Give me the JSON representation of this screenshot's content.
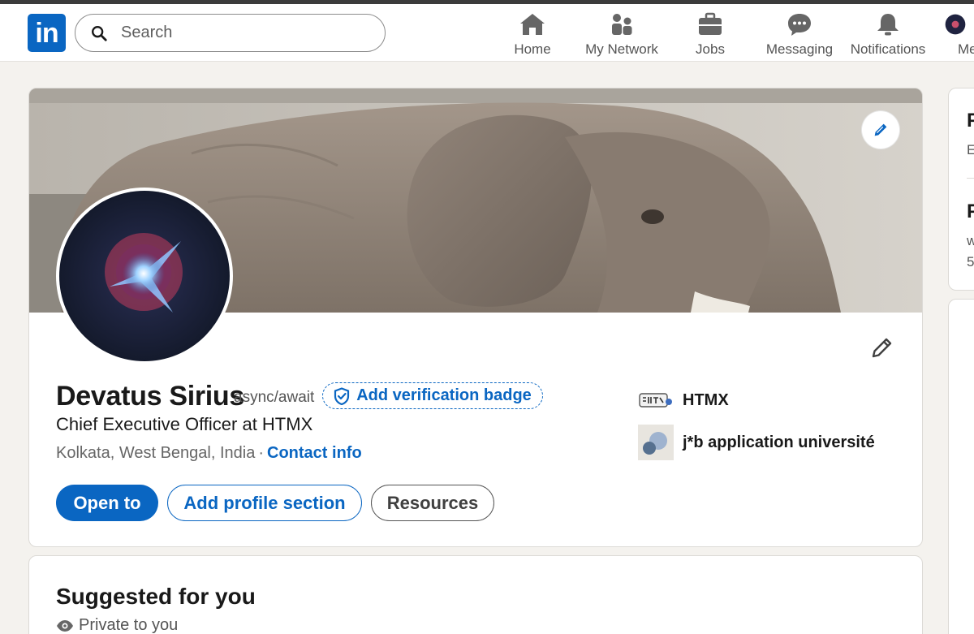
{
  "colors": {
    "brand": "#0a66c2",
    "background": "#f4f2ee",
    "card": "#ffffff"
  },
  "nav": {
    "logo_text": "in",
    "search_placeholder": "Search",
    "items": [
      {
        "label": "Home",
        "icon": "home-icon"
      },
      {
        "label": "My Network",
        "icon": "network-icon"
      },
      {
        "label": "Jobs",
        "icon": "briefcase-icon"
      },
      {
        "label": "Messaging",
        "icon": "messaging-icon"
      },
      {
        "label": "Notifications",
        "icon": "bell-icon"
      },
      {
        "label": "Me",
        "icon": "avatar"
      }
    ]
  },
  "profile": {
    "name": "Devatus Sirius",
    "pronouns": "async/await",
    "verification_label": "Add verification badge",
    "headline": "Chief Executive Officer at HTMX",
    "location": "Kolkata, West Bengal, India",
    "location_separator": "·",
    "contact_label": "Contact info",
    "buttons": {
      "open_to": "Open to",
      "add_section": "Add profile section",
      "resources": "Resources"
    },
    "organizations": [
      {
        "name": "HTMX",
        "icon": "htmx-logo"
      },
      {
        "name": "j*b application université",
        "icon": "school-placeholder-logo"
      }
    ]
  },
  "suggested": {
    "title": "Suggested for you",
    "privacy": "Private to you"
  },
  "sidebar": {
    "card1": {
      "heading_1": "P",
      "text_1": "E",
      "heading_2": "P",
      "text_2a": "w",
      "text_2b": "5"
    }
  }
}
